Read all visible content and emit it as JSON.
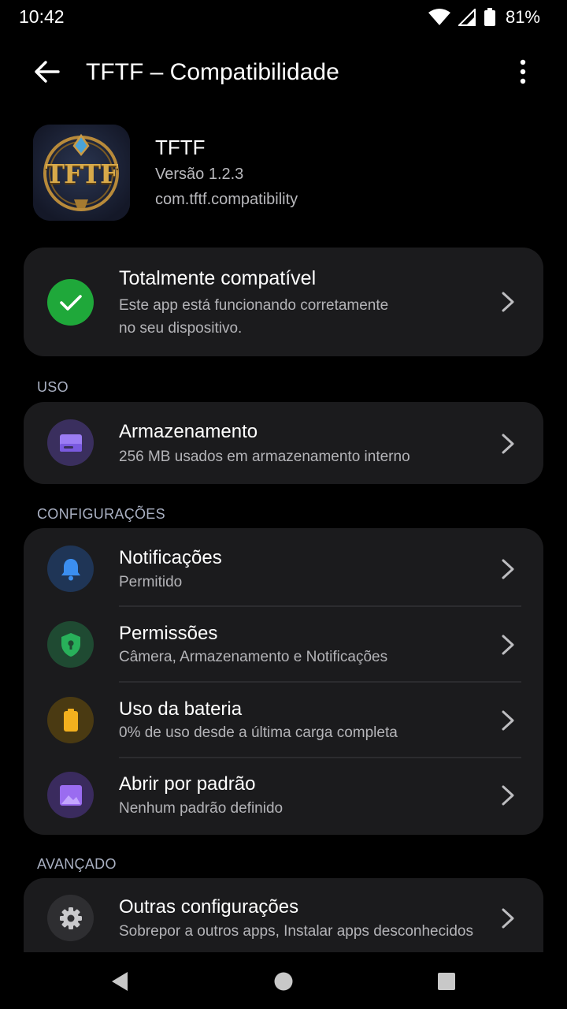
{
  "status_bar": {
    "time": "10:42",
    "battery_percent": "81%",
    "icons": [
      "wifi-icon",
      "cell-signal-icon",
      "battery-icon"
    ]
  },
  "app_bar": {
    "title": "TFTF – Compatibilidade",
    "back_icon": "arrow-back-icon",
    "more_icon": "more-vert-icon"
  },
  "app_info": {
    "name": "TFTF",
    "version": "Versão 1.2.3",
    "package": "com.tftf.compatibility",
    "icon_text": "TFTF"
  },
  "compat_card": {
    "title": "Totalmente compatível",
    "description_line1": "Este app está funcionando corretamente",
    "description_line2": "no seu dispositivo.",
    "icon": "check-circle-icon",
    "icon_color": "#1fa83a"
  },
  "sections": {
    "uso": "USO",
    "configuracoes": "CONFIGURAÇÕES",
    "avancado": "AVANÇADO"
  },
  "storage": {
    "title": "Armazenamento",
    "subtitle": "256 MB usados em armazenamento interno",
    "icon": "storage-icon",
    "icon_color": "#8e6cf0"
  },
  "settings": [
    {
      "title": "Notificações",
      "subtitle": "Permitido",
      "icon": "bell-icon",
      "icon_color": "#3b8ef0"
    },
    {
      "title": "Permissões",
      "subtitle": "Câmera, Armazenamento e Notificações",
      "icon": "shield-icon",
      "icon_color": "#28b05a"
    },
    {
      "title": "Uso da bateria",
      "subtitle": "0% de uso desde a última carga completa",
      "icon": "battery-icon",
      "icon_color": "#f2b01e"
    },
    {
      "title": "Abrir por padrão",
      "subtitle": "Nenhum padrão definido",
      "icon": "image-icon",
      "icon_color": "#9a6cf0"
    }
  ],
  "advanced": {
    "title": "Outras configurações",
    "subtitle": "Sobrepor a outros apps, Instalar apps desconhecidos",
    "icon": "gear-icon",
    "icon_color": "#c9c9cc"
  },
  "nav_bar": {
    "icons": [
      "nav-back-icon",
      "nav-home-icon",
      "nav-recents-icon"
    ]
  },
  "colors": {
    "background": "#000000",
    "card": "#1b1b1d",
    "section_label": "#a9b0c2"
  }
}
